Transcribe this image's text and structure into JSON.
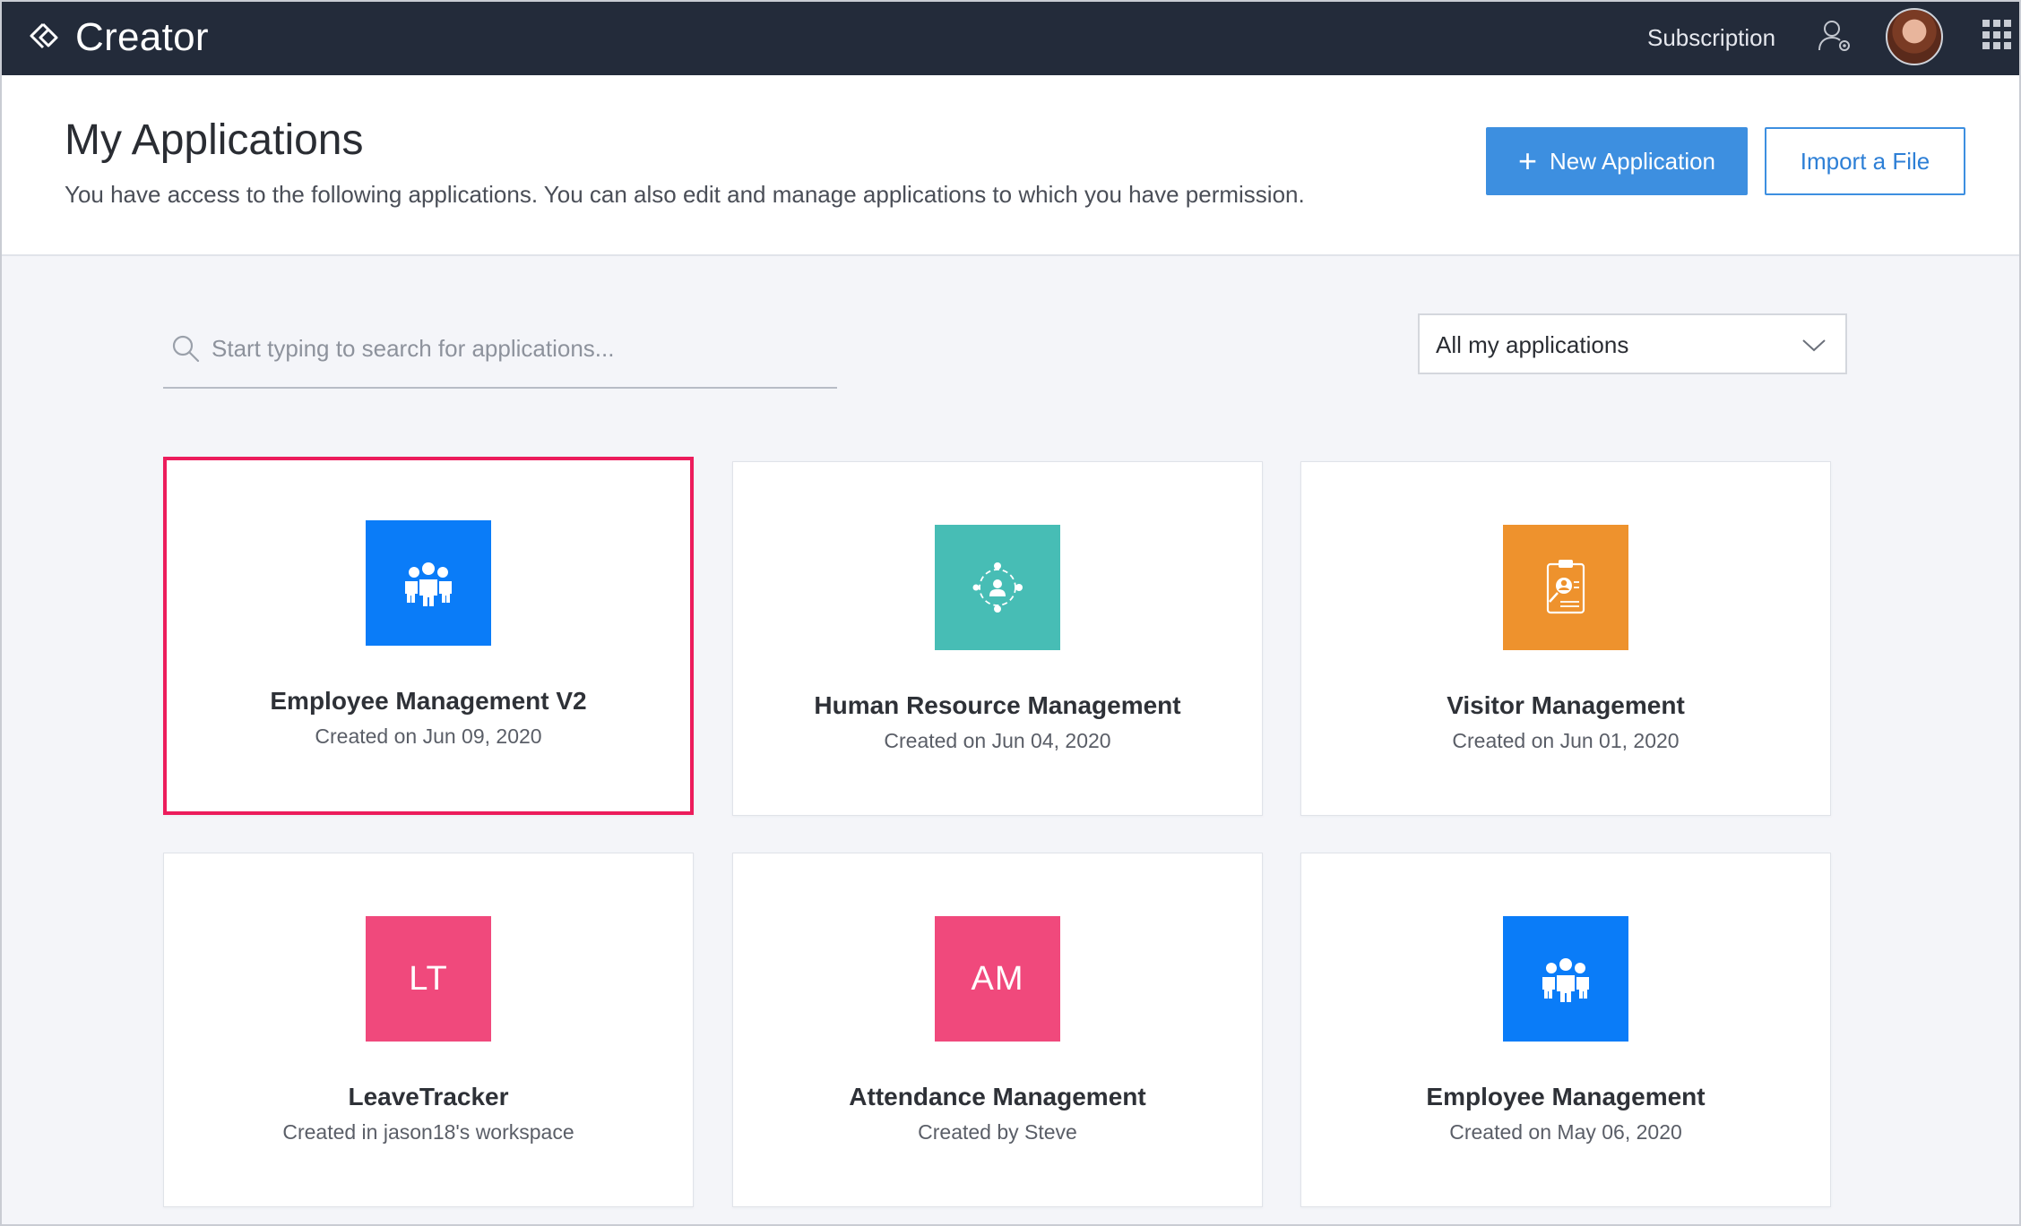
{
  "topbar": {
    "brand": "Creator",
    "subscription_label": "Subscription",
    "icons": [
      "creator-logo-icon",
      "user-settings-icon",
      "apps-grid-icon"
    ]
  },
  "header": {
    "title": "My Applications",
    "description": "You have access to the following applications. You can also edit and manage applications to which you have permission.",
    "new_app_label": "New Application",
    "import_label": "Import a File"
  },
  "search": {
    "placeholder": "Start typing to search for applications..."
  },
  "filter": {
    "selected": "All my applications"
  },
  "colors": {
    "topbar": "#232b3a",
    "primary": "#3d8fe0",
    "selected_border": "#ec1c5c",
    "tile_blue": "#0a7cf8",
    "tile_teal": "#47bdb5",
    "tile_orange": "#ee922d",
    "tile_pink": "#f0497c"
  },
  "apps": [
    {
      "name": "Employee Management V2",
      "meta": "Created on Jun 09, 2020",
      "tile": "",
      "icon": "people-group-icon",
      "color": "#0a7cf8",
      "selected": true
    },
    {
      "name": "Human Resource Management",
      "meta": "Created on Jun 04, 2020",
      "tile": "",
      "icon": "hr-network-icon",
      "color": "#47bdb5",
      "selected": false
    },
    {
      "name": "Visitor Management",
      "meta": "Created on Jun 01, 2020",
      "tile": "",
      "icon": "visitor-clipboard-icon",
      "color": "#ee922d",
      "selected": false
    },
    {
      "name": "LeaveTracker",
      "meta": "Created in jason18's workspace",
      "tile": "LT",
      "icon": "",
      "color": "#f0497c",
      "selected": false
    },
    {
      "name": "Attendance Management",
      "meta": "Created by Steve",
      "tile": "AM",
      "icon": "",
      "color": "#f0497c",
      "selected": false
    },
    {
      "name": "Employee Management",
      "meta": "Created on May 06, 2020",
      "tile": "",
      "icon": "people-group-icon",
      "color": "#0a7cf8",
      "selected": false
    }
  ]
}
